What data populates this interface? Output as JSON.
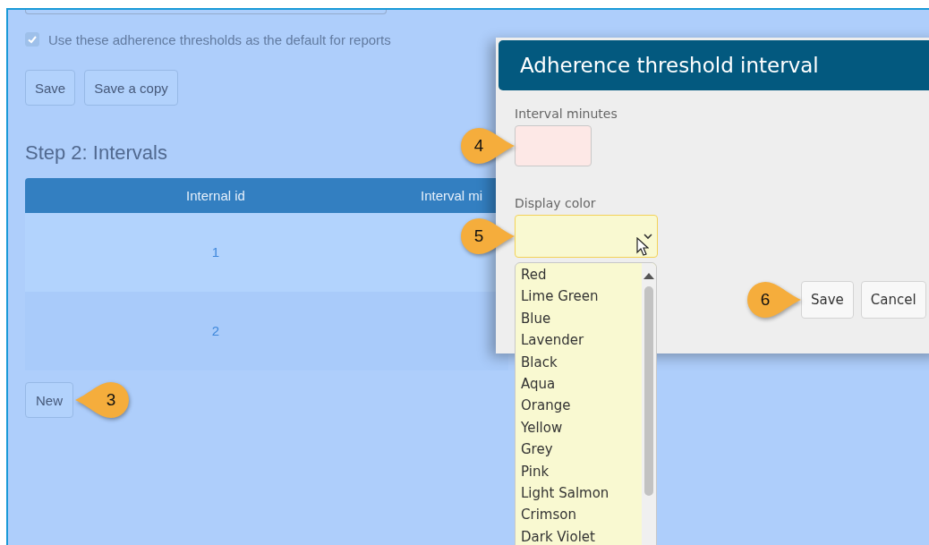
{
  "page": {
    "default_checkbox": {
      "label": "Use these adherence thresholds as the default for reports",
      "checked": true,
      "disabled": true
    },
    "buttons": [
      "Save",
      "Save a copy"
    ],
    "heading": "Step 2: Intervals",
    "table": {
      "columns": [
        "Internal id",
        "Interval mi"
      ],
      "rows": [
        [
          "1"
        ],
        [
          "2"
        ]
      ]
    },
    "new_button": {
      "label": "New",
      "callout": "3"
    }
  },
  "dialog": {
    "title": "Adherence threshold interval",
    "fields": [
      {
        "kind": "text",
        "label": "Interval minutes",
        "invalid": true,
        "callout": "4"
      },
      {
        "kind": "select",
        "label": "Display color",
        "highlighted": true,
        "open": true,
        "callout": "5",
        "options": [
          "Red",
          "Lime Green",
          "Blue",
          "Lavender",
          "Black",
          "Aqua",
          "Orange",
          "Yellow",
          "Grey",
          "Pink",
          "Light Salmon",
          "Crimson",
          "Dark Violet"
        ]
      }
    ],
    "buttons": [
      {
        "label": "Save",
        "callout": "6"
      },
      {
        "label": "Cancel"
      }
    ]
  }
}
